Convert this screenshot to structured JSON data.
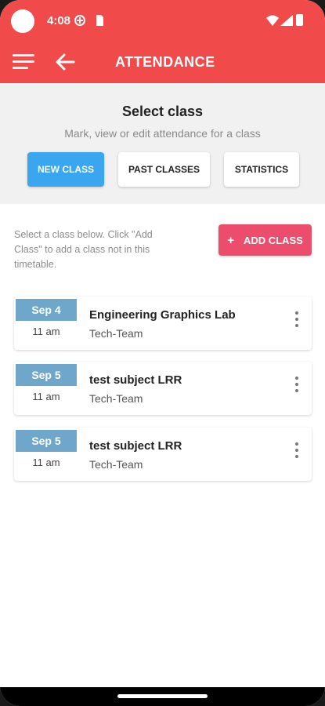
{
  "status_bar": {
    "time": "4:08"
  },
  "app_bar": {
    "title": "ATTENDANCE"
  },
  "panel": {
    "title": "Select class",
    "subtitle": "Mark, view or edit attendance for a class",
    "buttons": [
      "NEW CLASS",
      "PAST CLASSES",
      "STATISTICS"
    ]
  },
  "hint": "Select a class below. Click \"Add Class\" to add a class not in this timetable.",
  "add_class": {
    "plus": "+",
    "label": "ADD CLASS"
  },
  "classes": [
    {
      "date": "Sep 4",
      "time": "11 am",
      "name": "Engineering Graphics Lab",
      "team": "Tech-Team"
    },
    {
      "date": "Sep 5",
      "time": "11 am",
      "name": "test subject LRR",
      "team": "Tech-Team"
    },
    {
      "date": "Sep 5",
      "time": "11 am",
      "name": "test subject LRR",
      "team": "Tech-Team"
    }
  ],
  "colors": {
    "header": "#f04a4a",
    "primary_button": "#3aa6f0",
    "add_button": "#ec4d6c",
    "date_badge": "#6ea7c9"
  }
}
